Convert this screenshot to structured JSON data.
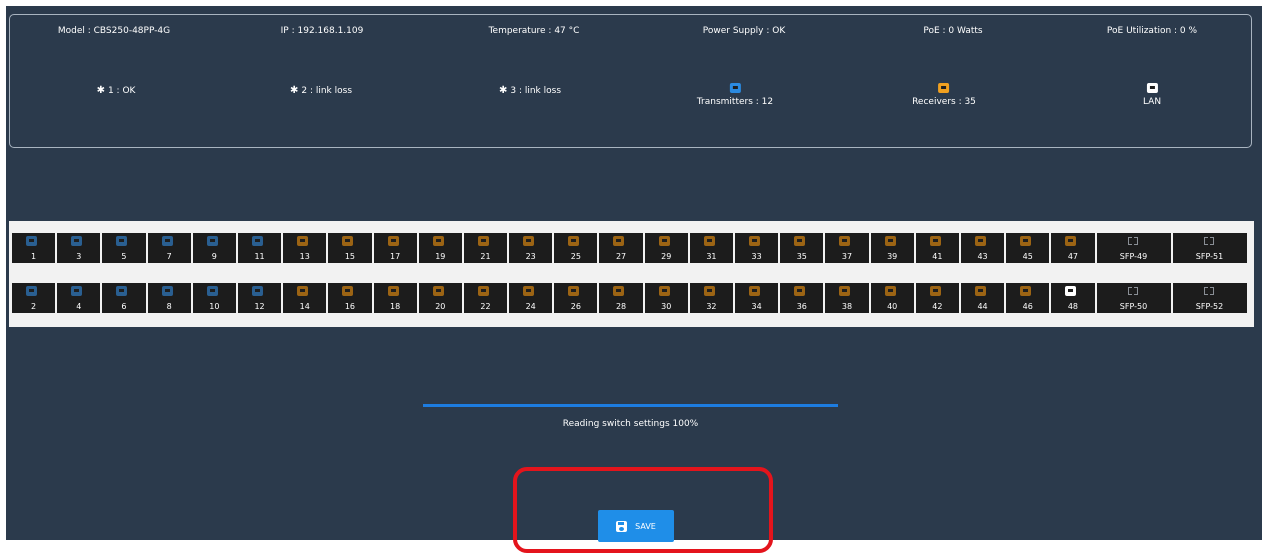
{
  "info": {
    "model": "Model : CBS250-48PP-4G",
    "ip": "IP : 192.168.1.109",
    "temperature": "Temperature : 47 °C",
    "power_supply": "Power Supply : OK",
    "poe": "PoE : 0 Watts",
    "poe_util": "PoE Utilization : 0 %"
  },
  "fans": [
    {
      "label": "1 : OK",
      "glyph": "✱"
    },
    {
      "label": "2 : link loss",
      "glyph": "✱"
    },
    {
      "label": "3 : link loss",
      "glyph": "✱"
    }
  ],
  "legend": {
    "transmitters": {
      "label": "Transmitters : 12",
      "color": "#2b8ae0"
    },
    "receivers": {
      "label": "Receivers : 35",
      "color": "#f0a020"
    },
    "lan": {
      "label": "LAN",
      "color": "#ffffff"
    }
  },
  "ports": {
    "odd": [
      {
        "n": "1",
        "t": "blue-dim"
      },
      {
        "n": "3",
        "t": "blue-dim"
      },
      {
        "n": "5",
        "t": "blue-dim"
      },
      {
        "n": "7",
        "t": "blue-dim"
      },
      {
        "n": "9",
        "t": "blue-dim"
      },
      {
        "n": "11",
        "t": "blue-dim"
      },
      {
        "n": "13",
        "t": "orange-dim"
      },
      {
        "n": "15",
        "t": "orange-dim"
      },
      {
        "n": "17",
        "t": "orange-dim"
      },
      {
        "n": "19",
        "t": "orange-dim"
      },
      {
        "n": "21",
        "t": "orange-dim"
      },
      {
        "n": "23",
        "t": "orange-dim"
      },
      {
        "n": "25",
        "t": "orange-dim"
      },
      {
        "n": "27",
        "t": "orange-dim"
      },
      {
        "n": "29",
        "t": "orange-dim"
      },
      {
        "n": "31",
        "t": "orange-dim"
      },
      {
        "n": "33",
        "t": "orange-dim"
      },
      {
        "n": "35",
        "t": "orange-dim"
      },
      {
        "n": "37",
        "t": "orange-dim"
      },
      {
        "n": "39",
        "t": "orange-dim"
      },
      {
        "n": "41",
        "t": "orange-dim"
      },
      {
        "n": "43",
        "t": "orange-dim"
      },
      {
        "n": "45",
        "t": "orange-dim"
      },
      {
        "n": "47",
        "t": "orange-dim"
      }
    ],
    "even": [
      {
        "n": "2",
        "t": "blue-dim"
      },
      {
        "n": "4",
        "t": "blue-dim"
      },
      {
        "n": "6",
        "t": "blue-dim"
      },
      {
        "n": "8",
        "t": "blue-dim"
      },
      {
        "n": "10",
        "t": "blue-dim"
      },
      {
        "n": "12",
        "t": "blue-dim"
      },
      {
        "n": "14",
        "t": "orange-dim"
      },
      {
        "n": "16",
        "t": "orange-dim"
      },
      {
        "n": "18",
        "t": "orange-dim"
      },
      {
        "n": "20",
        "t": "orange-dim"
      },
      {
        "n": "22",
        "t": "orange-dim"
      },
      {
        "n": "24",
        "t": "orange-dim"
      },
      {
        "n": "26",
        "t": "orange-dim"
      },
      {
        "n": "28",
        "t": "orange-dim"
      },
      {
        "n": "30",
        "t": "orange-dim"
      },
      {
        "n": "32",
        "t": "orange-dim"
      },
      {
        "n": "34",
        "t": "orange-dim"
      },
      {
        "n": "36",
        "t": "orange-dim"
      },
      {
        "n": "38",
        "t": "orange-dim"
      },
      {
        "n": "40",
        "t": "orange-dim"
      },
      {
        "n": "42",
        "t": "orange-dim"
      },
      {
        "n": "44",
        "t": "orange-dim"
      },
      {
        "n": "46",
        "t": "orange-dim"
      },
      {
        "n": "48",
        "t": "white"
      }
    ],
    "sfp_odd": [
      "SFP-49",
      "SFP-51"
    ],
    "sfp_even": [
      "SFP-50",
      "SFP-52"
    ]
  },
  "progress": {
    "text": "Reading switch settings 100%",
    "value": 100
  },
  "save": {
    "label": "SAVE"
  },
  "colors": {
    "background": "#2b3a4c",
    "accent": "#1f8ee8",
    "highlight": "#e4141c"
  }
}
